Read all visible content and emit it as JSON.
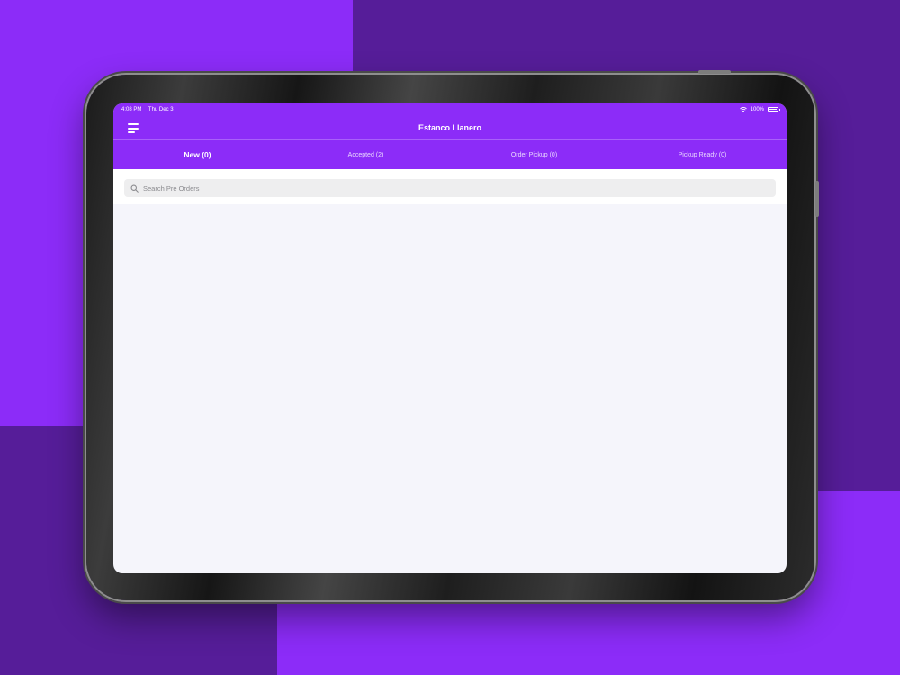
{
  "colors": {
    "brand": "#8c2cf8",
    "background_dark": "#561d99",
    "content_bg": "#f5f5fb",
    "search_bg": "#eeeeef"
  },
  "status_bar": {
    "time": "4:08 PM",
    "date": "Thu Dec 3",
    "battery": "100%",
    "icons": [
      "wifi-icon",
      "battery-icon"
    ]
  },
  "nav": {
    "title": "Estanco Llanero",
    "menu_icon": "hamburger-menu-icon"
  },
  "tabs": [
    {
      "label": "New (0)",
      "active": true
    },
    {
      "label": "Accepted (2)",
      "active": false
    },
    {
      "label": "Order Pickup (0)",
      "active": false
    },
    {
      "label": "Pickup Ready (0)",
      "active": false
    }
  ],
  "search": {
    "placeholder": "Search Pre Orders",
    "value": "",
    "icon": "search-icon"
  }
}
